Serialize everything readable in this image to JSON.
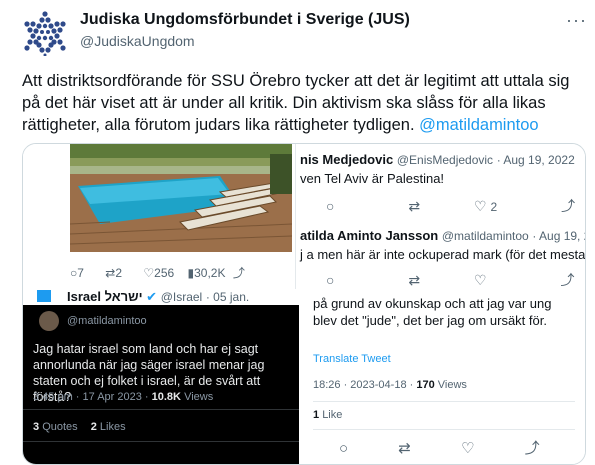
{
  "header": {
    "display_name": "Judiska Ungdomsförbundet i Sverige (JUS)",
    "handle": "@JudiskaUngdom",
    "more_icon": "more-icon"
  },
  "tweet": {
    "text": "Att distriktsordförande för SSU Örebro tycker att det är legitimt att uttala sig på det här viset att är under all kritik. Din aktivism ska slåss för alla likas rättigheter, alla förutom judars lika rättigheter tydligen. ",
    "mention": "@matildamintoo"
  },
  "image_tl": {
    "stats": {
      "replies": "7",
      "retweets": "2",
      "likes": "256",
      "views": "30,2K"
    }
  },
  "image_tr": {
    "tweet1": {
      "name": "nis Medjedovic",
      "handle": "@EnisMedjedovic",
      "date": "· Aug 19, 2022",
      "text": "ven Tel Aviv är Palestina!",
      "retweets": "2"
    },
    "tweet2": {
      "name": "atilda Aminto Jansson",
      "handle": "@matildamintoo",
      "date": "· Aug 19, 20",
      "text": "j a men här är inte ockuperad mark (för det mesta)"
    }
  },
  "image_bl": {
    "israel_name": "Israel",
    "israel_hebrew": "ישראל",
    "israel_handle": "@Israel",
    "israel_date": "· 05 jan.",
    "quoted_handle": "@matildamintoo",
    "quoted_text": "Jag hatar israel som land och har ej sagt annorlunda när jag säger israel menar jag staten och ej folket i israel, är de svårt att förstå?",
    "time": "3:45 pm · 17 Apr 2023 ·",
    "views_count": "10.8K",
    "views_label": "Views",
    "quotes_count": "3",
    "quotes_label": "Quotes",
    "likes_count": "2",
    "likes_label": "Likes"
  },
  "image_br": {
    "text": "på grund av okunskap och att jag var ung blev det \"jude\", det ber jag om ursäkt för.",
    "translate": "Translate Tweet",
    "meta": "18:26 · 2023-04-18 ·",
    "views_count": "170",
    "views_label": "Views",
    "likes_count": "1",
    "likes_label": "Like"
  },
  "colors": {
    "accent": "#1d9bf0",
    "muted": "#536471",
    "logo": "#2f4a8a"
  }
}
